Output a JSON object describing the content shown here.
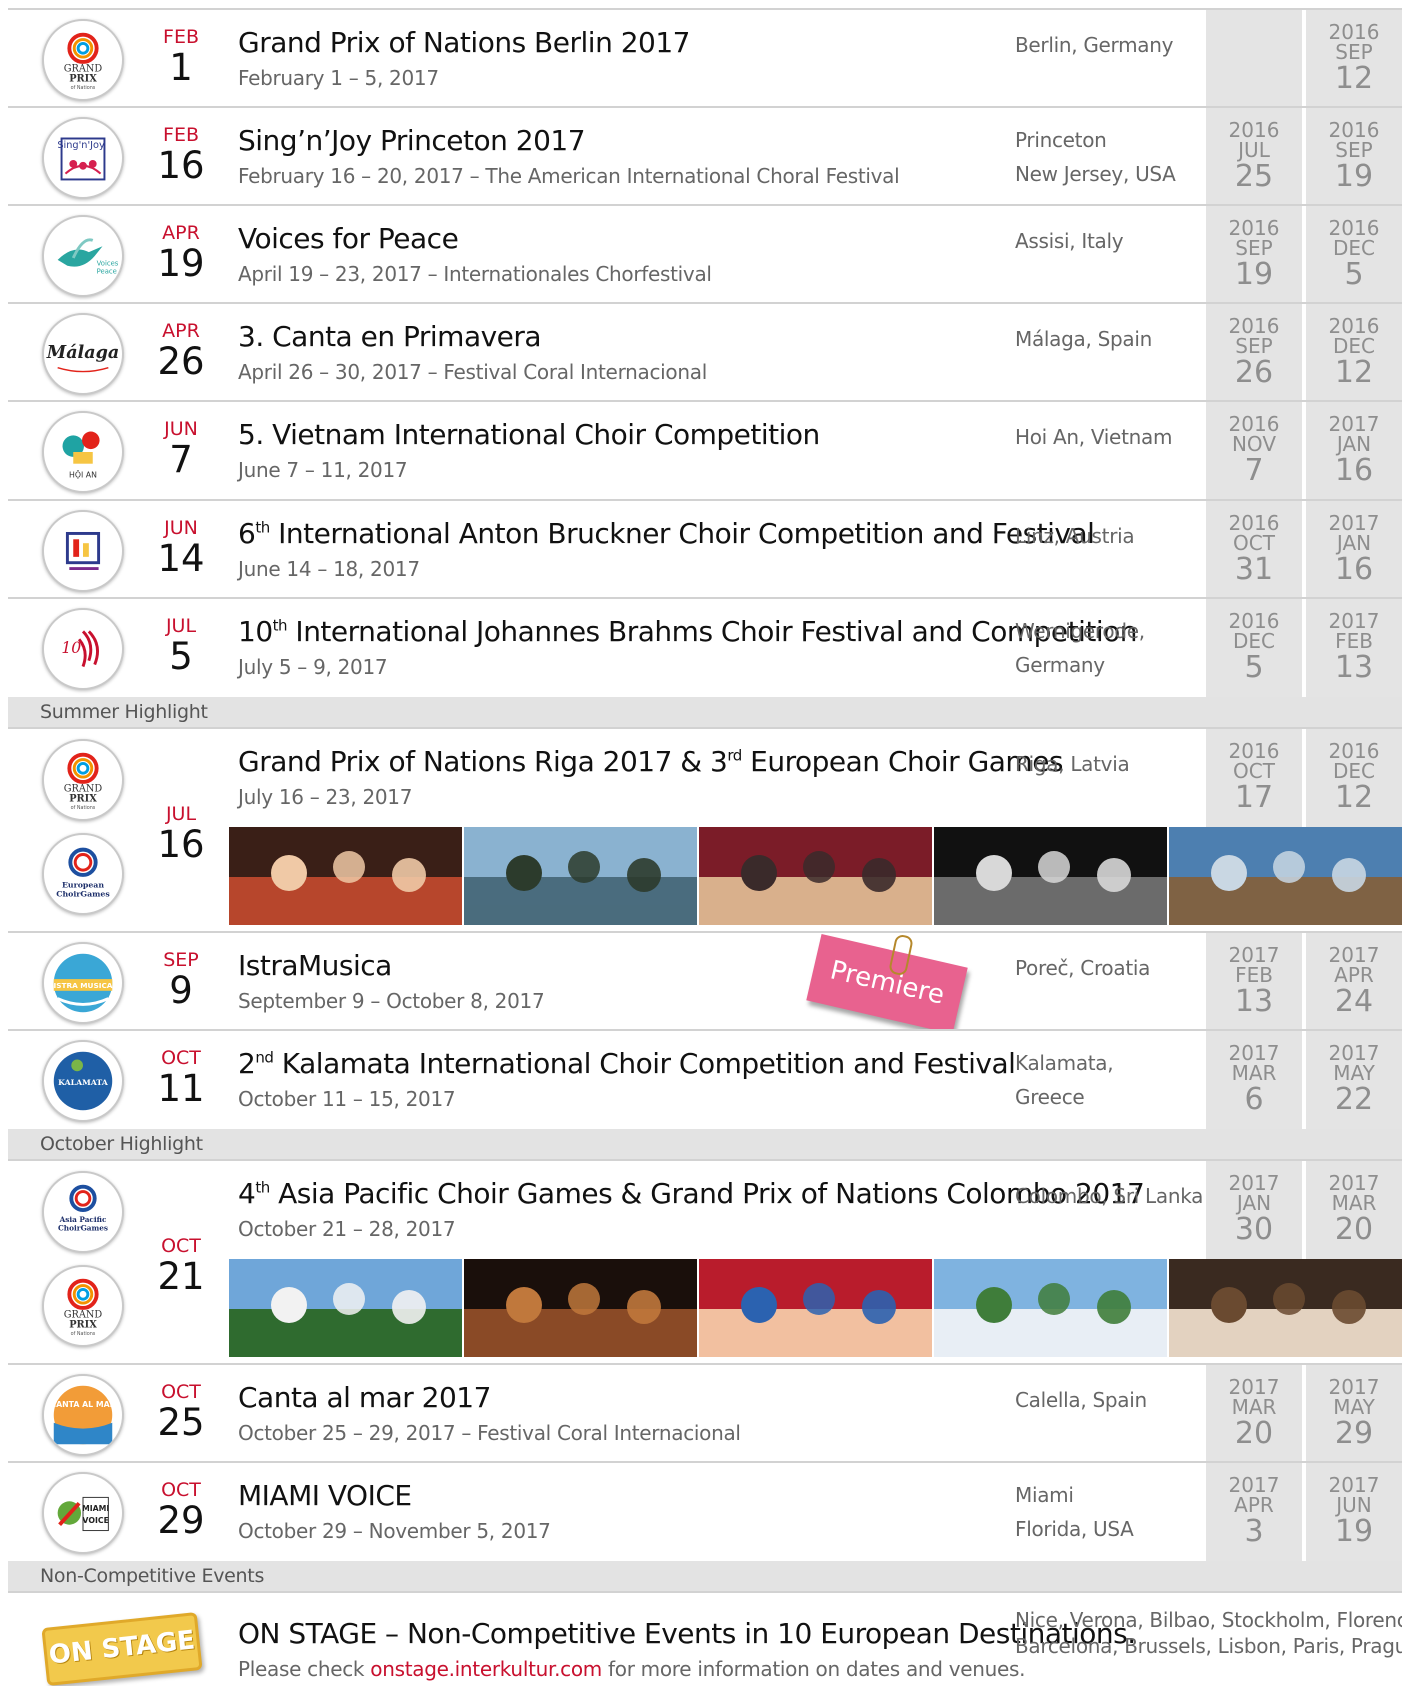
{
  "sections": {
    "summer": "Summer Highlight",
    "october": "October Highlight",
    "noncomp": "Non-Competitive Events"
  },
  "events": [
    {
      "month": "FEB",
      "day": "1",
      "title": "Grand Prix of Nations Berlin 2017",
      "sub": "February 1 – 5, 2017",
      "loc1": "Berlin, Germany",
      "loc2": "",
      "d1": {
        "y": "",
        "m": "",
        "d": ""
      },
      "d2": {
        "y": "2016",
        "m": "SEP",
        "d": "12"
      },
      "logo": "grand-prix"
    },
    {
      "month": "FEB",
      "day": "16",
      "title": "Sing’n’Joy Princeton 2017",
      "sub": "February 16 – 20, 2017 – The American International Choral Festival",
      "loc1": "Princeton",
      "loc2": "New Jersey, USA",
      "d1": {
        "y": "2016",
        "m": "JUL",
        "d": "25"
      },
      "d2": {
        "y": "2016",
        "m": "SEP",
        "d": "19"
      },
      "logo": "sing-n-joy"
    },
    {
      "month": "APR",
      "day": "19",
      "title": "Voices for Peace",
      "sub": "April 19 – 23, 2017 – Internationales Chorfestival",
      "loc1": "Assisi, Italy",
      "loc2": "",
      "d1": {
        "y": "2016",
        "m": "SEP",
        "d": "19"
      },
      "d2": {
        "y": "2016",
        "m": "DEC",
        "d": "5"
      },
      "logo": "voices-for-peace"
    },
    {
      "month": "APR",
      "day": "26",
      "title": "3. Canta en Primavera",
      "sub": "April 26 – 30, 2017 – Festival Coral Internacional",
      "loc1": "Málaga, Spain",
      "loc2": "",
      "d1": {
        "y": "2016",
        "m": "SEP",
        "d": "26"
      },
      "d2": {
        "y": "2016",
        "m": "DEC",
        "d": "12"
      },
      "logo": "malaga"
    },
    {
      "month": "JUN",
      "day": "7",
      "title": "5. Vietnam International Choir Competition",
      "sub": "June 7 – 11, 2017",
      "loc1": "Hoi An, Vietnam",
      "loc2": "",
      "d1": {
        "y": "2016",
        "m": "NOV",
        "d": "7"
      },
      "d2": {
        "y": "2017",
        "m": "JAN",
        "d": "16"
      },
      "logo": "hoi-an"
    },
    {
      "month": "JUN",
      "day": "14",
      "title_pre": "6",
      "title_sup": "th",
      "title": " International Anton Bruckner Choir Competition and Festival",
      "sub": "June 14 – 18, 2017",
      "loc1": "Linz, Austria",
      "loc2": "",
      "d1": {
        "y": "2016",
        "m": "OCT",
        "d": "31"
      },
      "d2": {
        "y": "2017",
        "m": "JAN",
        "d": "16"
      },
      "logo": "bruckner"
    },
    {
      "month": "JUL",
      "day": "5",
      "title_pre": "10",
      "title_sup": "th",
      "title": " International Johannes Brahms Choir Festival and Competition",
      "sub": "July 5 – 9, 2017",
      "loc1": "Wernigerode,",
      "loc2": "Germany",
      "d1": {
        "y": "2016",
        "m": "DEC",
        "d": "5"
      },
      "d2": {
        "y": "2017",
        "m": "FEB",
        "d": "13"
      },
      "logo": "brahms"
    },
    {
      "month": "JUL",
      "day": "16",
      "title_pre": "Grand Prix of Nations Riga 2017 & 3",
      "title_sup": "rd",
      "title": " European Choir Games",
      "sub": "July 16 – 23, 2017",
      "loc1": "Riga, Latvia",
      "loc2": "",
      "d1": {
        "y": "2016",
        "m": "OCT",
        "d": "17"
      },
      "d2": {
        "y": "2016",
        "m": "DEC",
        "d": "12"
      },
      "logo": "grand-prix",
      "logo2": "european-choir-games"
    },
    {
      "month": "SEP",
      "day": "9",
      "title": "IstraMusica",
      "sub": "September 9 – October 8, 2017",
      "loc1": "Poreč, Croatia",
      "loc2": "",
      "d1": {
        "y": "2017",
        "m": "FEB",
        "d": "13"
      },
      "d2": {
        "y": "2017",
        "m": "APR",
        "d": "24"
      },
      "logo": "istra-musica",
      "badge": "Premiere"
    },
    {
      "month": "OCT",
      "day": "11",
      "title_pre": "2",
      "title_sup": "nd",
      "title": " Kalamata International Choir Competition and Festival",
      "sub": "October 11 – 15, 2017",
      "loc1": "Kalamata,",
      "loc2": "Greece",
      "d1": {
        "y": "2017",
        "m": "MAR",
        "d": "6"
      },
      "d2": {
        "y": "2017",
        "m": "MAY",
        "d": "22"
      },
      "logo": "kalamata"
    },
    {
      "month": "OCT",
      "day": "21",
      "title_pre": "4",
      "title_sup": "th",
      "title": " Asia Pacific Choir Games & Grand Prix of Nations Colombo 2017",
      "sub": "October 21 – 28, 2017",
      "loc1": "Colombo, Sri Lanka",
      "loc2": "",
      "d1": {
        "y": "2017",
        "m": "JAN",
        "d": "30"
      },
      "d2": {
        "y": "2017",
        "m": "MAR",
        "d": "20"
      },
      "logo": "asia-pacific-choir-games",
      "logo2": "grand-prix"
    },
    {
      "month": "OCT",
      "day": "25",
      "title": "Canta al mar 2017",
      "sub": "October 25 – 29, 2017 – Festival Coral Internacional",
      "loc1": "Calella, Spain",
      "loc2": "",
      "d1": {
        "y": "2017",
        "m": "MAR",
        "d": "20"
      },
      "d2": {
        "y": "2017",
        "m": "MAY",
        "d": "29"
      },
      "logo": "canta-al-mar"
    },
    {
      "month": "OCT",
      "day": "29",
      "title": "MIAMI VOICE",
      "sub": "October 29 – November 5, 2017",
      "loc1": "Miami",
      "loc2": "Florida, USA",
      "d1": {
        "y": "2017",
        "m": "APR",
        "d": "3"
      },
      "d2": {
        "y": "2017",
        "m": "JUN",
        "d": "19"
      },
      "logo": "miami-voice"
    }
  ],
  "logo_text": {
    "grand_prix_1": "GRAND",
    "grand_prix_2": "PRIX",
    "grand_prix_3": "of Nations",
    "sing_n_joy": "Sing'n'Joy",
    "voices_for_peace": "Voices for Peace",
    "malaga": "Málaga",
    "hoi_an": "HỘI AN",
    "ecg_1": "European",
    "ecg_2": "ChoirGames",
    "apcg_1": "Asia Pacific",
    "apcg_2": "ChoirGames",
    "istra": "ISTRA MUSICA",
    "kalamata": "KALAMATA",
    "canta": "CANTA AL MAR",
    "miami_1": "MIAMI",
    "miami_2": "VOICE"
  },
  "onstage": {
    "badge": "ON STAGE",
    "title": "ON STAGE – Non-Competitive Events in 10 European Destinations.",
    "sub_pre": "Please check ",
    "link": "onstage.interkultur.com",
    "sub_post": " for more information on dates and venues.",
    "loc1": "Nice, Verona, Bilbao, Stockholm, Florence,",
    "loc2": "Barcelona, Brussels, Lisbon, Paris, Prague"
  },
  "colors": {
    "accent_red": "#c8102e",
    "grey_col": "#e4e4e4",
    "premiere_pink": "#e8628f"
  }
}
